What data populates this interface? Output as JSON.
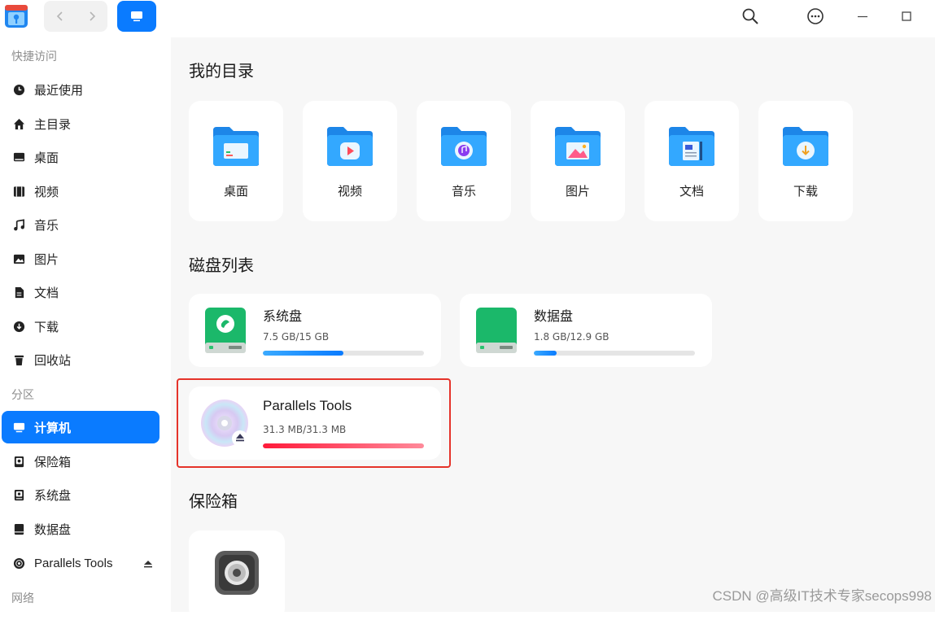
{
  "colors": {
    "accent": "#0a7bff",
    "highlight": "#e5332a",
    "disk_bar": "#1a8cff",
    "tools_bar": "#ff2a3d"
  },
  "titlebar": {
    "back_icon": "chevron-left-icon",
    "forward_icon": "chevron-right-icon",
    "view_icon": "monitor-icon",
    "search_icon": "search-icon",
    "menu_icon": "more-icon",
    "minimize_icon": "minimize-icon",
    "maximize_icon": "maximize-icon"
  },
  "sidebar": {
    "quick_access_label": "快捷访问",
    "quick_items": [
      {
        "label": "最近使用",
        "icon": "clock-icon"
      },
      {
        "label": "主目录",
        "icon": "home-icon"
      },
      {
        "label": "桌面",
        "icon": "desktop-icon"
      },
      {
        "label": "视频",
        "icon": "film-icon"
      },
      {
        "label": "音乐",
        "icon": "music-icon"
      },
      {
        "label": "图片",
        "icon": "image-icon"
      },
      {
        "label": "文档",
        "icon": "document-icon"
      },
      {
        "label": "下载",
        "icon": "download-icon"
      },
      {
        "label": "回收站",
        "icon": "trash-icon"
      }
    ],
    "partitions_label": "分区",
    "partition_items": [
      {
        "label": "计算机",
        "icon": "computer-icon",
        "active": true
      },
      {
        "label": "保险箱",
        "icon": "vault-icon"
      },
      {
        "label": "系统盘",
        "icon": "disk-icon"
      },
      {
        "label": "数据盘",
        "icon": "disk-icon"
      },
      {
        "label": "Parallels Tools",
        "icon": "cdrom-icon",
        "eject": true
      }
    ],
    "network_label": "网络"
  },
  "main": {
    "my_dirs_title": "我的目录",
    "folders": [
      {
        "label": "桌面",
        "icon": "desktop-folder-icon"
      },
      {
        "label": "视频",
        "icon": "video-folder-icon"
      },
      {
        "label": "音乐",
        "icon": "music-folder-icon"
      },
      {
        "label": "图片",
        "icon": "pictures-folder-icon"
      },
      {
        "label": "文档",
        "icon": "documents-folder-icon"
      },
      {
        "label": "下载",
        "icon": "downloads-folder-icon"
      }
    ],
    "disks_title": "磁盘列表",
    "disks": [
      {
        "name": "系统盘",
        "size": "7.5 GB/15 GB",
        "usage": 0.5
      },
      {
        "name": "数据盘",
        "size": "1.8 GB/12.9 GB",
        "usage": 0.14
      },
      {
        "name": "Parallels Tools",
        "size": "31.3 MB/31.3 MB",
        "usage": 1.0
      }
    ],
    "vault_title": "保险箱"
  },
  "watermark": "CSDN @高级IT技术专家secops998"
}
